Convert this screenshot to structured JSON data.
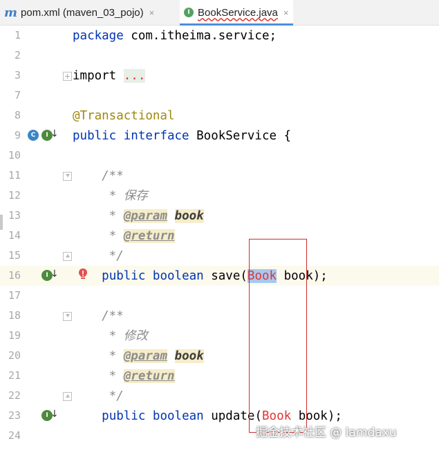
{
  "tabs": [
    {
      "icon": "maven-m-icon",
      "label": "pom.xml (maven_03_pojo)",
      "close": "×"
    },
    {
      "icon": "interface-icon",
      "icon_text": "I",
      "label": "BookService.java",
      "close": "×",
      "active": true
    }
  ],
  "lines": {
    "1": {
      "num": "1",
      "kw": "package",
      "rest": " com.itheima.service;"
    },
    "2": {
      "num": "2"
    },
    "3": {
      "num": "3",
      "kw": "import",
      "fold": "..."
    },
    "7": {
      "num": "7"
    },
    "8": {
      "num": "8",
      "ann": "@Transactional"
    },
    "9": {
      "num": "9",
      "kw1": "public",
      "kw2": "interface",
      "rest": " BookService {"
    },
    "10": {
      "num": "10"
    },
    "11": {
      "num": "11",
      "text": "    /**"
    },
    "12": {
      "num": "12",
      "star": "     * ",
      "text": "保存"
    },
    "13": {
      "num": "13",
      "star": "     * ",
      "tag": "@param",
      "param": "book"
    },
    "14": {
      "num": "14",
      "star": "     * ",
      "tag": "@return"
    },
    "15": {
      "num": "15",
      "text": "     */"
    },
    "16": {
      "num": "16",
      "indent": "    ",
      "kw1": "public",
      "kw2": "boolean",
      "method": "save(",
      "type": "Book",
      "rest": " book);"
    },
    "17": {
      "num": "17"
    },
    "18": {
      "num": "18",
      "text": "    /**"
    },
    "19": {
      "num": "19",
      "star": "     * ",
      "text": "修改"
    },
    "20": {
      "num": "20",
      "star": "     * ",
      "tag": "@param",
      "param": "book"
    },
    "21": {
      "num": "21",
      "star": "     * ",
      "tag": "@return"
    },
    "22": {
      "num": "22",
      "text": "     */"
    },
    "23": {
      "num": "23",
      "indent": "    ",
      "kw1": "public",
      "kw2": "boolean",
      "method": "update(",
      "type": "Book",
      "rest": " book);"
    },
    "24": {
      "num": "24"
    }
  },
  "gutter": {
    "interface_icon_text": "I",
    "class_icon_text": "C",
    "arrow": "↓"
  },
  "watermark": "掘金技术社区 @ lamdaxu",
  "colors": {
    "keyword": "#0033b3",
    "annotation": "#9e880d",
    "comment": "#8c8c8c",
    "error": "#e53333",
    "highlight_row": "#fcfaed",
    "selection": "#a6c8f0",
    "annotation_box": "#cc2b2b"
  }
}
